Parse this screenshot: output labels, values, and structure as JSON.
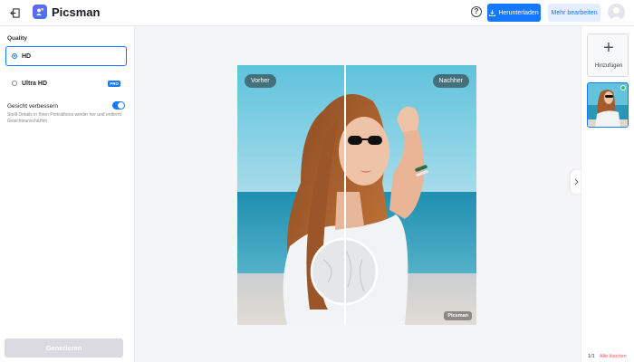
{
  "app": {
    "name": "Picsman"
  },
  "header": {
    "help_label": "?",
    "download_label": "Herunterladen",
    "more_edit_label": "Mehr bearbeiten"
  },
  "settings": {
    "quality_label": "Quality",
    "options": [
      {
        "label": "HD",
        "selected": true
      },
      {
        "label": "Ultra HD",
        "selected": false,
        "badge": "PRO"
      }
    ],
    "face_enhance": {
      "label": "Gesicht verbessern",
      "enabled": true,
      "description": "Stellt Details in Ihren Porträtfotos wieder her und entfernt Gesichtsunschärfen"
    },
    "generate_label": "Generieren"
  },
  "preview": {
    "before_label": "Vorher",
    "after_label": "Nachher",
    "watermark": "Picsman"
  },
  "gallery": {
    "add_label": "Hinzufügen",
    "count": "1/1",
    "delete_all_label": "Alle löschen"
  },
  "colors": {
    "accent": "#1677ff",
    "accent_light": "#e3efff",
    "danger": "#ff4d4f",
    "disabled": "#d9dbe0"
  }
}
